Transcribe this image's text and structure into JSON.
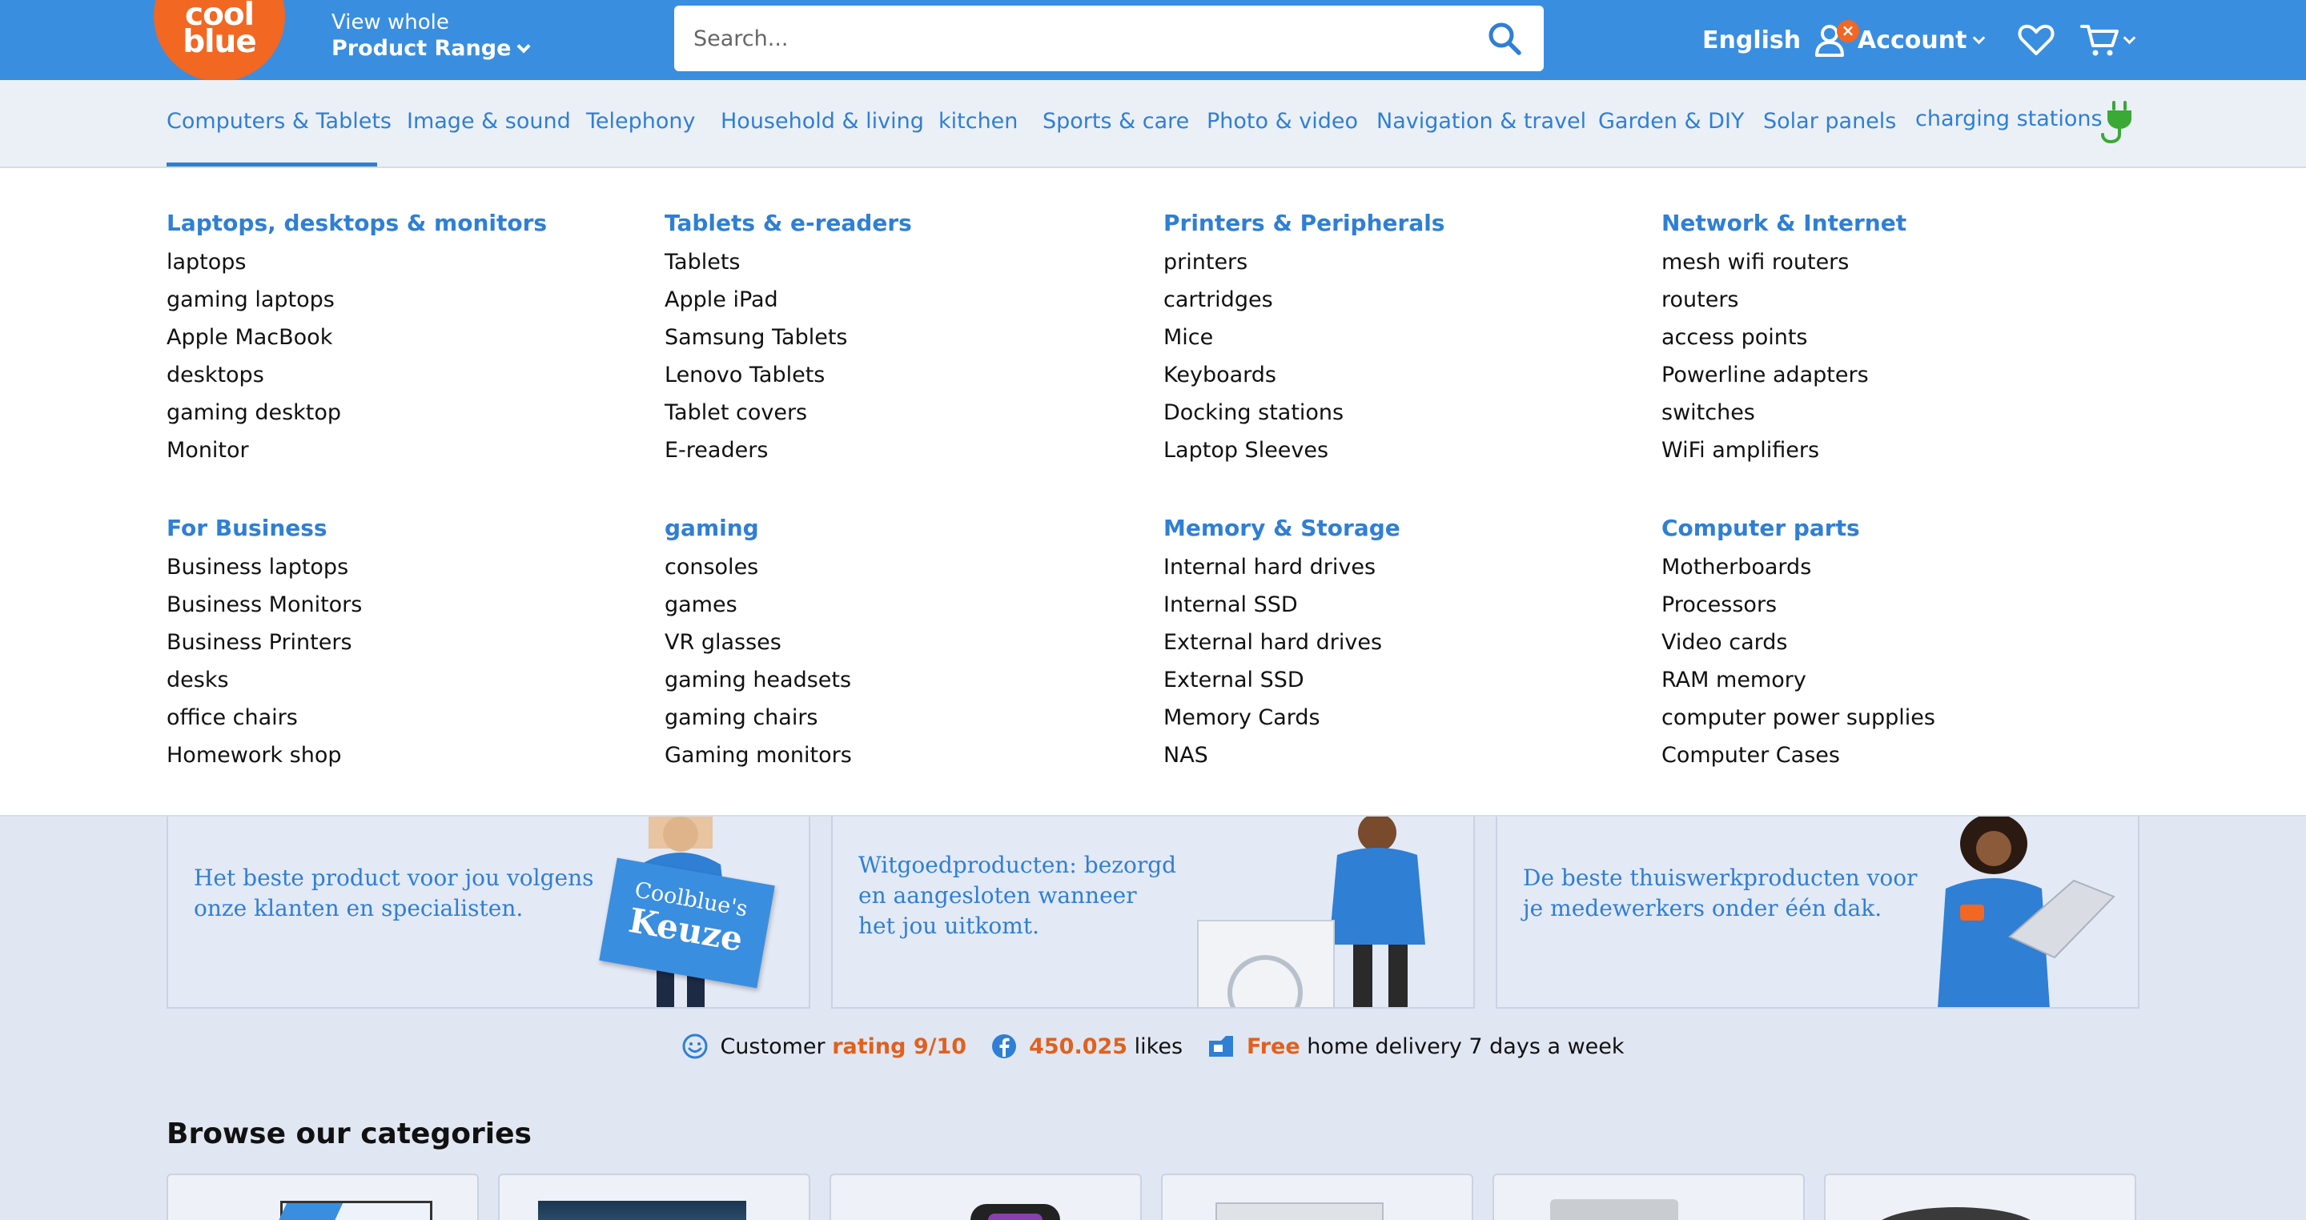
{
  "header": {
    "logo_text_1": "cool",
    "logo_text_2": "blue",
    "view_whole": "View whole",
    "product_range": "Product Range",
    "search_placeholder": "Search...",
    "language": "English",
    "account": "Account",
    "account_badge": "×"
  },
  "nav": {
    "items": [
      "Computers & Tablets",
      "Image & sound",
      "Telephony",
      "Household & living",
      "kitchen",
      "Sports & care",
      "Photo & video",
      "Navigation & travel",
      "Garden & DIY",
      "Solar panels",
      "charging stations"
    ],
    "active": "Computers & Tablets"
  },
  "menu": {
    "columns": [
      {
        "groups": [
          {
            "title": "Laptops, desktops & monitors",
            "links": [
              "laptops",
              "gaming laptops",
              "Apple MacBook",
              "desktops",
              "gaming desktop",
              "Monitor"
            ]
          },
          {
            "title": "For Business",
            "links": [
              "Business laptops",
              "Business Monitors",
              "Business Printers",
              "desks",
              "office chairs",
              "Homework shop"
            ]
          }
        ]
      },
      {
        "groups": [
          {
            "title": "Tablets & e-readers",
            "links": [
              "Tablets",
              "Apple iPad",
              "Samsung Tablets",
              "Lenovo Tablets",
              "Tablet covers",
              "E-readers"
            ]
          },
          {
            "title": "gaming",
            "links": [
              "consoles",
              "games",
              "VR glasses",
              "gaming headsets",
              "gaming chairs",
              "Gaming monitors"
            ]
          }
        ]
      },
      {
        "groups": [
          {
            "title": "Printers & Peripherals",
            "links": [
              "printers",
              "cartridges",
              "Mice",
              "Keyboards",
              "Docking stations",
              "Laptop Sleeves"
            ]
          },
          {
            "title": "Memory & Storage",
            "links": [
              "Internal hard drives",
              "Internal SSD",
              "External hard drives",
              "External SSD",
              "Memory Cards",
              "NAS"
            ]
          }
        ]
      },
      {
        "groups": [
          {
            "title": "Network & Internet",
            "links": [
              "mesh wifi routers",
              "routers",
              "access points",
              "Powerline adapters",
              "switches",
              "WiFi amplifiers"
            ]
          },
          {
            "title": "Computer parts",
            "links": [
              "Motherboards",
              "Processors",
              "Video cards",
              "RAM memory",
              "computer power supplies",
              "Computer Cases"
            ]
          }
        ]
      }
    ]
  },
  "promos": [
    {
      "line1": "Het beste product voor jou volgens",
      "line2": "onze klanten en specialisten.",
      "line3": "",
      "sign1": "Coolblue's",
      "sign2": "Keuze"
    },
    {
      "line1": "Witgoedproducten: bezorgd",
      "line2": "en aangesloten wanneer",
      "line3": "het jou uitkomt."
    },
    {
      "line1": "De beste thuiswerkproducten voor",
      "line2": "je medewerkers onder één dak.",
      "line3": ""
    }
  ],
  "usp": {
    "rating_pre": "Customer",
    "rating_hl": "rating 9/10",
    "likes_hl": "450.025",
    "likes_post": "likes",
    "delivery_hl": "Free",
    "delivery_post": "home delivery 7 days a week"
  },
  "browse": {
    "title": "Browse our categories"
  },
  "colors": {
    "brand_blue": "#3a8ee0",
    "brand_orange": "#f26722",
    "link_blue": "#2f7fd4",
    "highlight_orange": "#e0611f",
    "plug_green": "#3aa935"
  },
  "icons": {
    "search": "search-icon",
    "account": "user-icon",
    "wishlist": "heart-icon",
    "cart": "cart-icon",
    "charging": "plug-icon",
    "rating": "smiley-icon",
    "facebook": "facebook-icon",
    "delivery": "delivery-box-icon"
  }
}
